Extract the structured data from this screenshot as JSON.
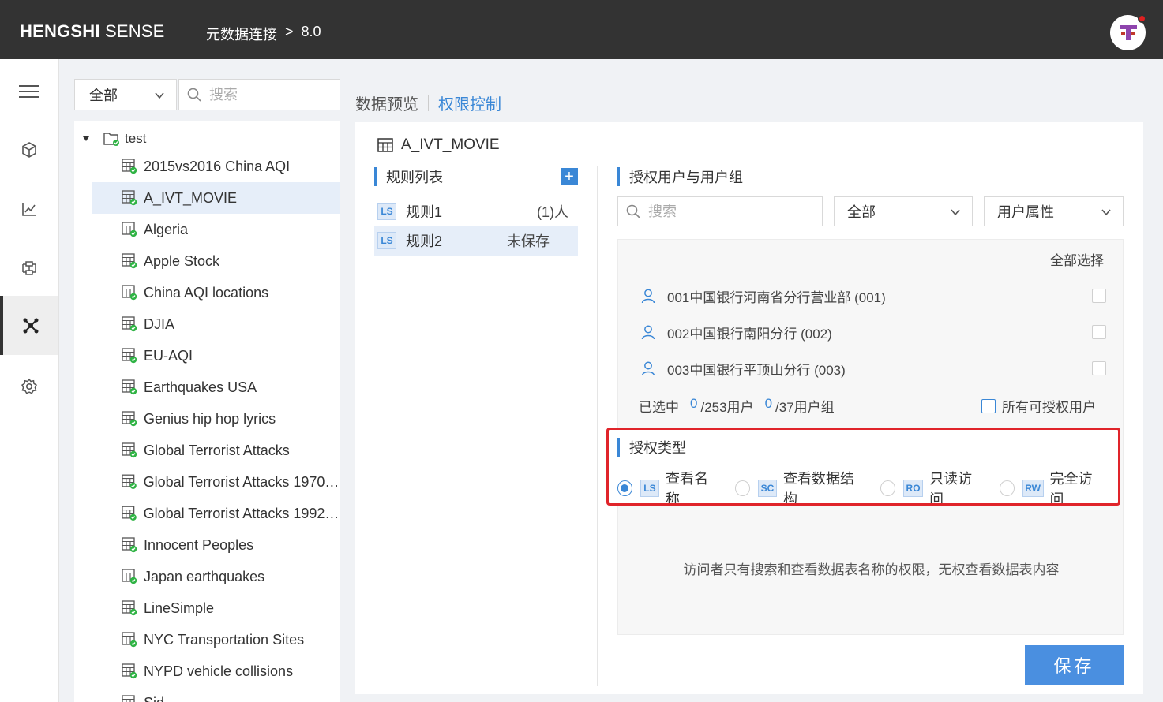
{
  "header": {
    "brand_bold": "HENGSHI",
    "brand_light": "SENSE",
    "breadcrumb": {
      "parent": "元数据连接",
      "separator": ">",
      "current": "8.0"
    }
  },
  "sidebar_nav": {
    "items": [
      {
        "icon": "menu-icon"
      },
      {
        "icon": "cube-icon"
      },
      {
        "icon": "chart-icon"
      },
      {
        "icon": "data-flow-icon"
      },
      {
        "icon": "network-icon",
        "active": true
      },
      {
        "icon": "gear-icon"
      }
    ]
  },
  "dataset_panel": {
    "filter": {
      "value": "全部"
    },
    "search": {
      "placeholder": "搜索"
    },
    "root": {
      "label": "test"
    },
    "items": [
      "2015vs2016 China AQI",
      "A_IVT_MOVIE",
      "Algeria",
      "Apple Stock",
      "China AQI locations",
      "DJIA",
      "EU-AQI",
      "Earthquakes USA",
      "Genius hip hop lyrics",
      "Global Terrorist Attacks",
      "Global Terrorist Attacks 1970 t...",
      "Global Terrorist Attacks 1992 t...",
      "Innocent Peoples",
      "Japan earthquakes",
      "LineSimple",
      "NYC Transportation Sites",
      "NYPD vehicle collisions",
      "Sid..."
    ],
    "selected_item": "A_IVT_MOVIE"
  },
  "tabs": {
    "preview": "数据预览",
    "permission": "权限控制"
  },
  "main": {
    "dataset_title": "A_IVT_MOVIE",
    "rules": {
      "heading": "规则列表",
      "add_label": "+",
      "items": [
        {
          "badge": "LS",
          "name": "规则1",
          "meta": "(1)人"
        },
        {
          "badge": "LS",
          "name": "规则2",
          "meta": "未保存"
        }
      ]
    },
    "users": {
      "heading": "授权用户与用户组",
      "search_placeholder": "搜索",
      "scope_filter": "全部",
      "attr_filter": "用户属性",
      "select_all": "全部选择",
      "list": [
        "001中国银行河南省分行营业部 (001)",
        "002中国银行南阳分行 (002)",
        "003中国银行平顶山分行 (003)"
      ],
      "selected_label": "已选中",
      "user_count": "0",
      "user_total": "/253用户",
      "group_count": "0",
      "group_total": "/37用户组",
      "all_authorized": "所有可授权用户"
    },
    "auth_type": {
      "heading": "授权类型",
      "options": [
        {
          "badge": "LS",
          "label": "查看名称",
          "checked": true
        },
        {
          "badge": "SC",
          "label": "查看数据结构",
          "checked": false
        },
        {
          "badge": "RO",
          "label": "只读访问",
          "checked": false
        },
        {
          "badge": "RW",
          "label": "完全访问",
          "checked": false
        }
      ],
      "description": "访问者只有搜索和查看数据表名称的权限，无权查看数据表内容"
    },
    "save_label": "保存"
  },
  "colors": {
    "accent": "#3a87d6",
    "topbar": "#333333",
    "highlight": "#e0242a",
    "selected_bg": "#e6eef9"
  }
}
